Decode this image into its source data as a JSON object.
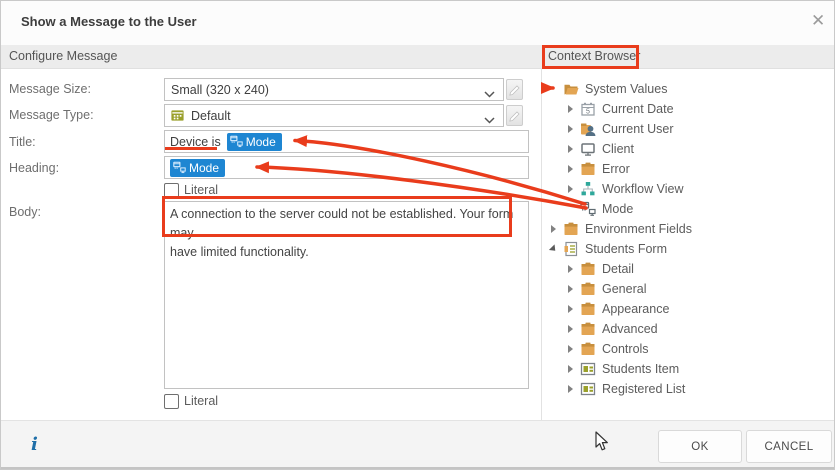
{
  "dialog": {
    "title": "Show a Message to the User"
  },
  "sections": {
    "configure_label": "Configure Message",
    "context_browser_label": "Context Browser"
  },
  "form": {
    "message_size_label": "Message Size:",
    "message_size_value": "Small (320 x 240)",
    "message_type_label": "Message Type:",
    "message_type_value": "Default",
    "title_label": "Title:",
    "title_text": "Device is",
    "title_token": "Mode",
    "heading_label": "Heading:",
    "heading_token": "Mode",
    "literal_label_top": "Literal",
    "body_label": "Body:",
    "body_lines": [
      "A connection to the server could not be established. Your form may",
      "have limited functionality."
    ],
    "literal_label_bottom": "Literal"
  },
  "tree": {
    "items": [
      {
        "label": "System Values",
        "icon": "folder-open",
        "level": 0,
        "expander": "none"
      },
      {
        "label": "Current Date",
        "icon": "calendar",
        "level": 1,
        "expander": "collapsed"
      },
      {
        "label": "Current User",
        "icon": "user",
        "level": 1,
        "expander": "collapsed"
      },
      {
        "label": "Client",
        "icon": "monitor",
        "level": 1,
        "expander": "collapsed"
      },
      {
        "label": "Error",
        "icon": "folder",
        "level": 1,
        "expander": "collapsed"
      },
      {
        "label": "Workflow View",
        "icon": "workflow",
        "level": 1,
        "expander": "collapsed"
      },
      {
        "label": "Mode",
        "icon": "mode",
        "level": 1,
        "expander": "none"
      },
      {
        "label": "Environment Fields",
        "icon": "folder",
        "level": 0,
        "expander": "collapsed"
      },
      {
        "label": "Students Form",
        "icon": "form",
        "level": 0,
        "expander": "expanded"
      },
      {
        "label": "Detail",
        "icon": "folder",
        "level": 1,
        "expander": "collapsed"
      },
      {
        "label": "General",
        "icon": "folder",
        "level": 1,
        "expander": "collapsed"
      },
      {
        "label": "Appearance",
        "icon": "folder",
        "level": 1,
        "expander": "collapsed"
      },
      {
        "label": "Advanced",
        "icon": "folder",
        "level": 1,
        "expander": "collapsed"
      },
      {
        "label": "Controls",
        "icon": "folder",
        "level": 1,
        "expander": "collapsed"
      },
      {
        "label": "Students Item",
        "icon": "listitem",
        "level": 1,
        "expander": "collapsed"
      },
      {
        "label": "Registered List",
        "icon": "listitem",
        "level": 1,
        "expander": "collapsed"
      }
    ]
  },
  "footer": {
    "ok_label": "OK",
    "cancel_label": "CANCEL"
  },
  "icons": {
    "close": "✕",
    "info": "i"
  },
  "colors": {
    "accent_blue": "#1e86d2",
    "annotation_red": "#e93c1c",
    "folder_tan": "#e3a553",
    "folder_tan_dark": "#c78f3e",
    "olive": "#9aa02c",
    "teal": "#2fa89b",
    "section_bar_gray": "#ececec"
  }
}
